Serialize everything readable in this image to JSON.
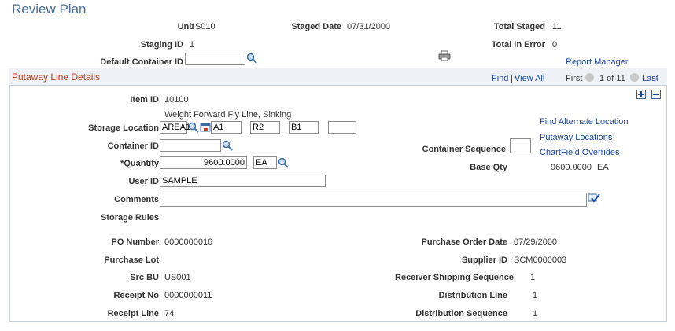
{
  "page": {
    "title": "Review Plan"
  },
  "header": {
    "unit_label": "Unit",
    "unit_value": "US010",
    "staged_date_label": "Staged Date",
    "staged_date_value": "07/31/2000",
    "total_staged_label": "Total Staged",
    "total_staged_value": "11",
    "staging_id_label": "Staging ID",
    "staging_id_value": "1",
    "total_error_label": "Total in Error",
    "total_error_value": "0",
    "default_container_label": "Default Container ID",
    "default_container_value": "",
    "report_manager": "Report Manager"
  },
  "grid": {
    "title": "Putaway Line Details",
    "find": "Find",
    "sep": "|",
    "view_all": "View All",
    "first": "First",
    "count": "1 of 11",
    "last": "Last"
  },
  "line": {
    "item_id_label": "Item ID",
    "item_id_value": "10100",
    "item_desc": "Weight Forward Fly Line, Sinking",
    "storage_location_label": "Storage Location",
    "storage_area": "AREA1",
    "storage_l1": "A1",
    "storage_l2": "R2",
    "storage_l3": "B1",
    "storage_l4": "",
    "container_id_label": "Container ID",
    "container_id_value": "",
    "container_seq_label": "Container Sequence",
    "container_seq_value": "",
    "quantity_label": "*Quantity",
    "quantity_value": "9600.0000",
    "quantity_uom": "EA",
    "base_qty_label": "Base Qty",
    "base_qty_value": "9600.0000",
    "base_qty_uom": "EA",
    "user_id_label": "User ID",
    "user_id_value": "SAMPLE",
    "comments_label": "Comments",
    "comments_value": "",
    "storage_rules_label": "Storage Rules",
    "find_alt_location": "Find Alternate Location",
    "putaway_locations": "Putaway Locations",
    "chartfield_overrides": "ChartField Overrides",
    "po_number_label": "PO Number",
    "po_number_value": "0000000016",
    "po_date_label": "Purchase Order Date",
    "po_date_value": "07/29/2000",
    "purchase_lot_label": "Purchase Lot",
    "supplier_id_label": "Supplier ID",
    "supplier_id_value": "SCM0000003",
    "src_bu_label": "Src BU",
    "src_bu_value": "US001",
    "recv_ship_seq_label": "Receiver Shipping Sequence",
    "recv_ship_seq_value": "1",
    "receipt_no_label": "Receipt No",
    "receipt_no_value": "0000000011",
    "dist_line_label": "Distribution Line",
    "dist_line_value": "1",
    "receipt_line_label": "Receipt Line",
    "receipt_line_value": "74",
    "dist_seq_label": "Distribution Sequence",
    "dist_seq_value": "1"
  },
  "icons": {
    "lookup": "magnifier-icon",
    "calendar": "calendar-icon",
    "print": "printer-icon",
    "add": "plus-icon",
    "delete": "minus-icon",
    "spell": "spellcheck-icon",
    "prev": "previous-arrow-icon",
    "next": "next-arrow-icon"
  },
  "colors": {
    "title": "#4a6f9a",
    "link": "#1a47a0",
    "section_title": "#b03a1c",
    "grid_header": "#eef2f6"
  }
}
